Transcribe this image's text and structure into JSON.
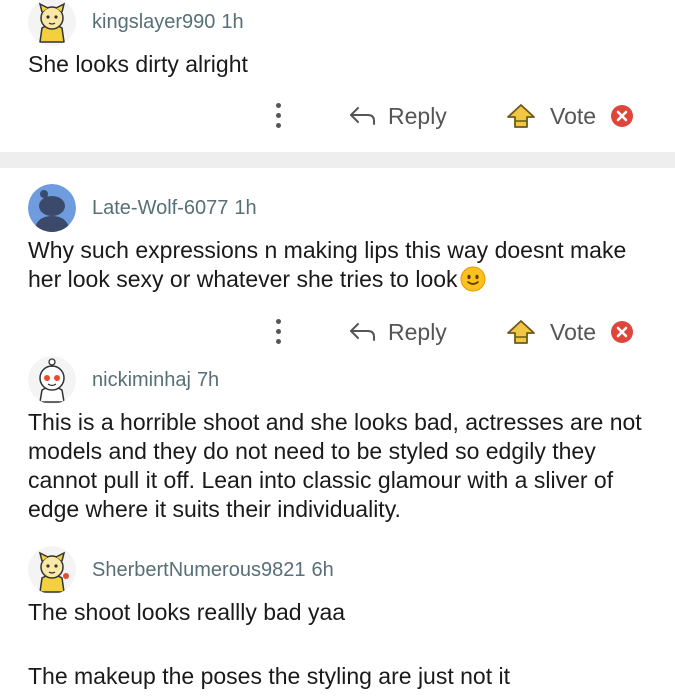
{
  "comments": [
    {
      "username": "kingslayer990",
      "age": "1h",
      "body": "She looks dirty alright"
    },
    {
      "username": "Late-Wolf-6077",
      "age": "1h",
      "body": "Why such expressions n making lips this way doesnt make her look sexy or whatever she tries to look",
      "emoji": "slightly-smiling-face"
    },
    {
      "username": "nickiminhaj",
      "age": "7h",
      "body": "This is a horrible shoot and she looks bad, actresses are not models and they do not need to be styled so edgily they cannot pull it off. Lean into classic glamour with a sliver of edge where it suits their individuality."
    },
    {
      "username": "SherbertNumerous9821",
      "age": "6h",
      "body_lines": [
        "The shoot looks reallly bad yaa",
        "The makeup the poses the styling are just not it"
      ]
    }
  ],
  "actions": {
    "reply_label": "Reply",
    "vote_label": "Vote"
  },
  "colors": {
    "username": "#576f76",
    "text": "#1a1a1b",
    "divider": "#eeeeee",
    "close": "#e0453a",
    "vote_icon": "#f2c744",
    "default_avatar": "#6f9bdf"
  }
}
